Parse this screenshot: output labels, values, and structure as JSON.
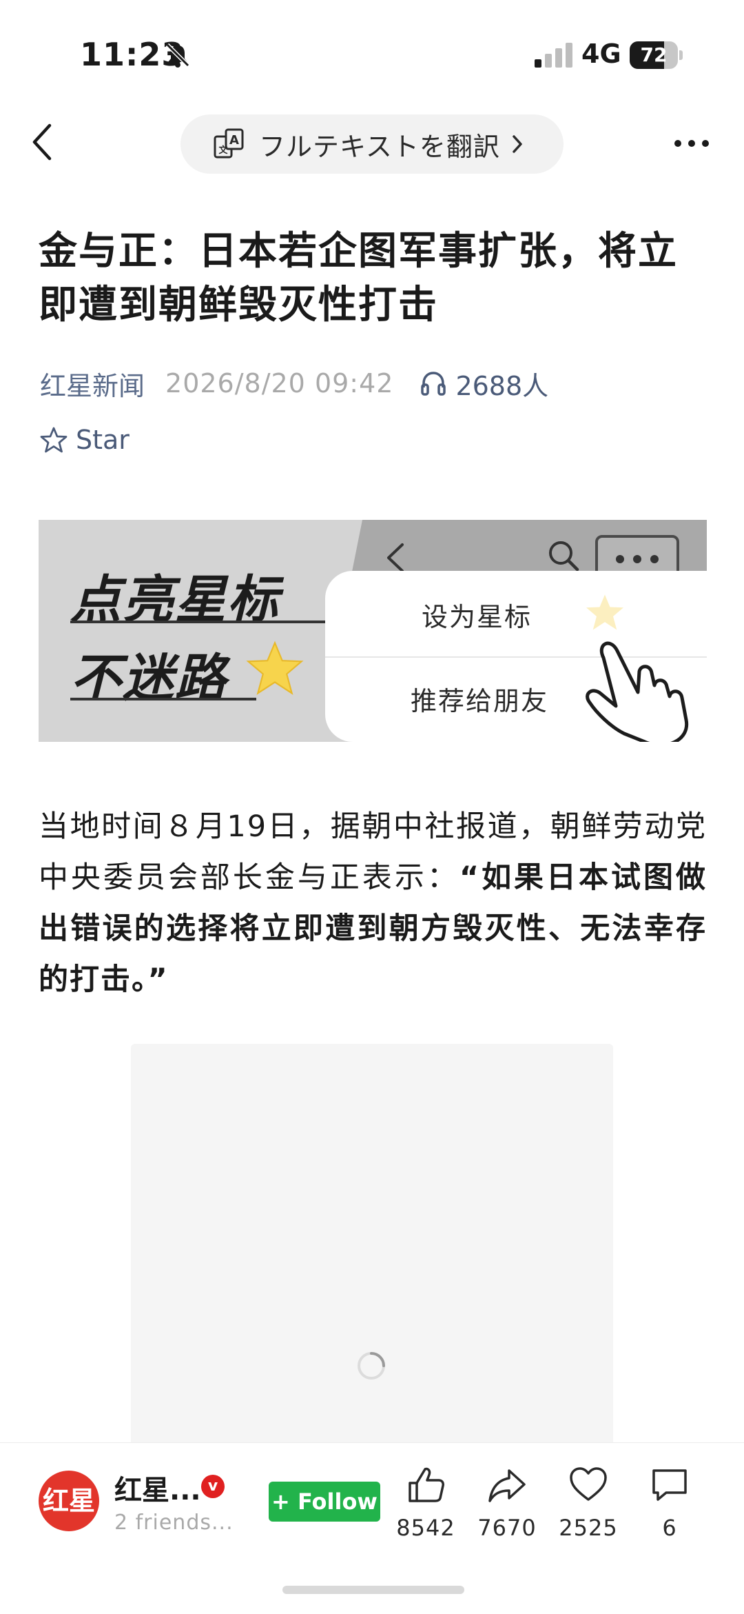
{
  "status_bar": {
    "time": "11:23",
    "network": "4G",
    "battery": "72",
    "battery_level": 0.72
  },
  "nav": {
    "translate_label": "フルテキストを翻訳"
  },
  "article": {
    "title": "金与正：日本若企图军事扩张，将立即遭到朝鲜毁灭性打击",
    "source": "红星新闻",
    "date": "2026/8/20 09:42",
    "listeners": "2688人",
    "star_label": "Star",
    "paragraph_normal": "当地时间８月19日，据朝中社报道，朝鲜劳动党中央委员会部长金与正表示：",
    "paragraph_bold": "“如果日本试图做出错误的选择将立即遭到朝方毁灭性、无法幸存的打击。”"
  },
  "banner": {
    "line1": "点亮星标",
    "line2": "不迷路",
    "menu_item1": "设为星标",
    "menu_item2": "推荐给朋友"
  },
  "bottom_bar": {
    "avatar_text": "红星",
    "author_name": "红星...",
    "verified_badge": "v",
    "author_sub": "2 friends...",
    "follow_label": "+ Follow",
    "like_count": "8542",
    "share_count": "7670",
    "favorite_count": "2525",
    "comment_count": "6"
  },
  "icons": {
    "back": "chevron-left-icon",
    "translate": "translate-icon",
    "more": "more-icon",
    "headphone": "headphone-icon",
    "star": "star-outline-icon",
    "like": "thumbs-up-icon",
    "share": "share-icon",
    "favorite": "heart-icon",
    "comment": "comment-icon"
  },
  "colors": {
    "follow_green": "#22b34b",
    "brand_red": "#e2352b",
    "meta_blue": "#5a6b8a"
  }
}
